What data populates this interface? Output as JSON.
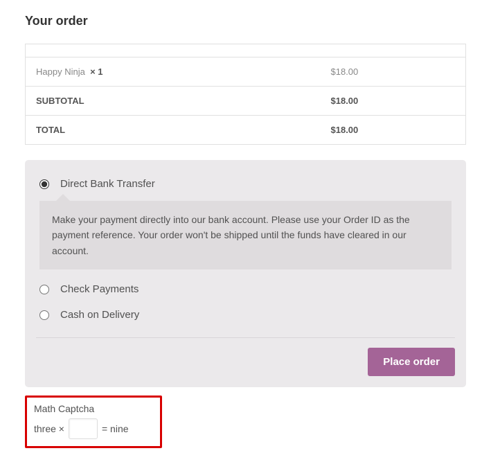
{
  "order": {
    "title": "Your order",
    "items": [
      {
        "name": "Happy Ninja",
        "qty": "× 1",
        "price": "$18.00"
      }
    ],
    "subtotal": {
      "label": "Subtotal",
      "value": "$18.00"
    },
    "total": {
      "label": "Total",
      "value": "$18.00"
    }
  },
  "payment": {
    "methods": {
      "bank": {
        "label": "Direct Bank Transfer",
        "desc": "Make your payment directly into our bank account. Please use your Order ID as the payment reference. Your order won't be shipped until the funds have cleared in our account."
      },
      "check": {
        "label": "Check Payments"
      },
      "cod": {
        "label": "Cash on Delivery"
      }
    },
    "place_order": "Place order"
  },
  "captcha": {
    "title": "Math Captcha",
    "left": "three ×",
    "right": "= nine",
    "value": ""
  }
}
